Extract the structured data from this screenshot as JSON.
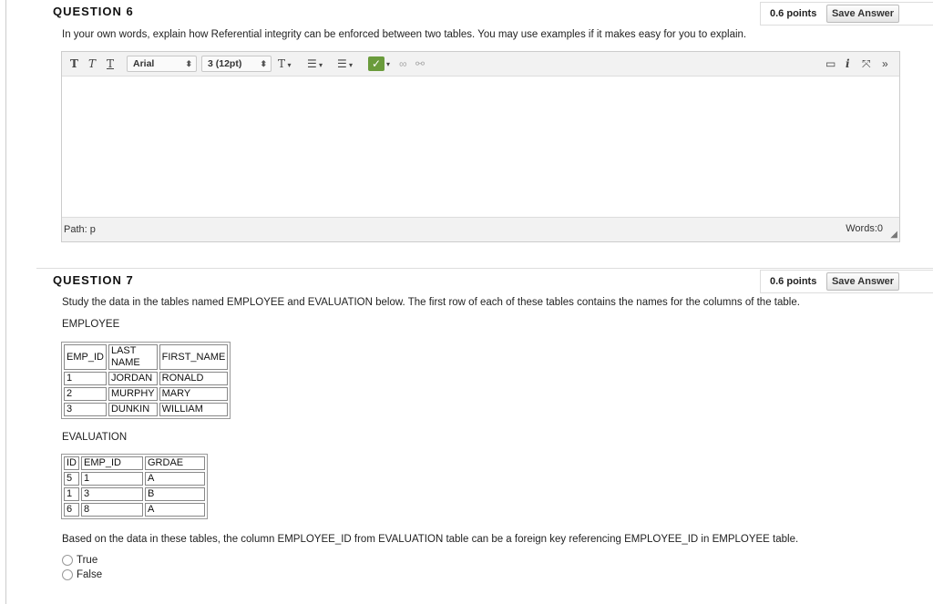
{
  "q6": {
    "title": "QUESTION 6",
    "points": "0.6 points",
    "save_label": "Save Answer",
    "prompt": "In your own words, explain how Referential integrity can be enforced between two tables. You may use examples if it makes easy for you to explain.",
    "editor": {
      "font_family": "Arial",
      "font_size": "3 (12pt)",
      "path": "Path: p",
      "words": "Words:0"
    }
  },
  "q7": {
    "title": "QUESTION 7",
    "points": "0.6 points",
    "save_label": "Save Answer",
    "prompt": "Study the data in the tables named EMPLOYEE and EVALUATION below. The first row of each of these tables contains the names for the columns of the table.",
    "employee_label": "EMPLOYEE",
    "employee_table": [
      [
        "EMP_ID",
        "LAST NAME",
        "FIRST_NAME"
      ],
      [
        "1",
        "JORDAN",
        "RONALD"
      ],
      [
        "2",
        "MURPHY",
        "MARY"
      ],
      [
        "3",
        "DUNKIN",
        "WILLIAM"
      ]
    ],
    "evaluation_label": "EVALUATION",
    "evaluation_table": [
      [
        "ID",
        "EMP_ID",
        "GRDAE"
      ],
      [
        "5",
        "1",
        "A"
      ],
      [
        "1",
        "3",
        "B"
      ],
      [
        "6",
        "8",
        "A"
      ]
    ],
    "statement": "Based on the data in these tables, the column EMPLOYEE_ID from EVALUATION table can be a foreign key referencing EMPLOYEE_ID in EMPLOYEE table.",
    "options": [
      "True",
      "False"
    ]
  }
}
